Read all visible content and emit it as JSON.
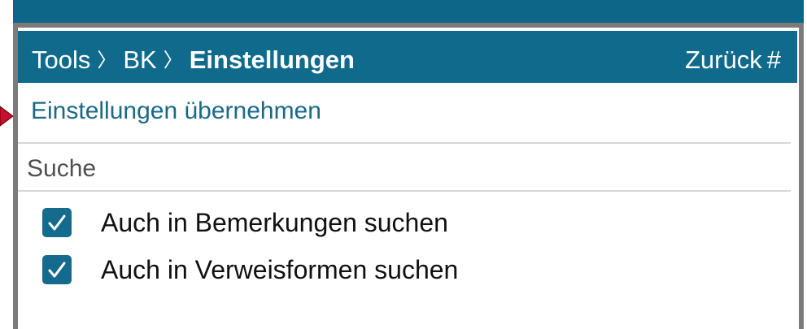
{
  "header": {
    "breadcrumb": [
      {
        "label": "Tools"
      },
      {
        "label": "BK"
      },
      {
        "label": "Einstellungen"
      }
    ],
    "back_label": "Zurück",
    "shortcut_hint": "#"
  },
  "apply": {
    "label": "Einstellungen übernehmen"
  },
  "search_section": {
    "title": "Suche",
    "options": [
      {
        "label": "Auch in Bemerkungen suchen",
        "checked": true
      },
      {
        "label": "Auch in Verweisformen suchen",
        "checked": true
      }
    ]
  },
  "colors": {
    "header_bg": "#0f6a8c",
    "accent": "#146b8d",
    "link": "#1a6987",
    "pointer": "#c8102e"
  },
  "icons": {
    "breadcrumb_separator": "chevron-right-icon",
    "checkbox": "checkmark-icon",
    "pointer": "pointer-arrow-icon"
  }
}
